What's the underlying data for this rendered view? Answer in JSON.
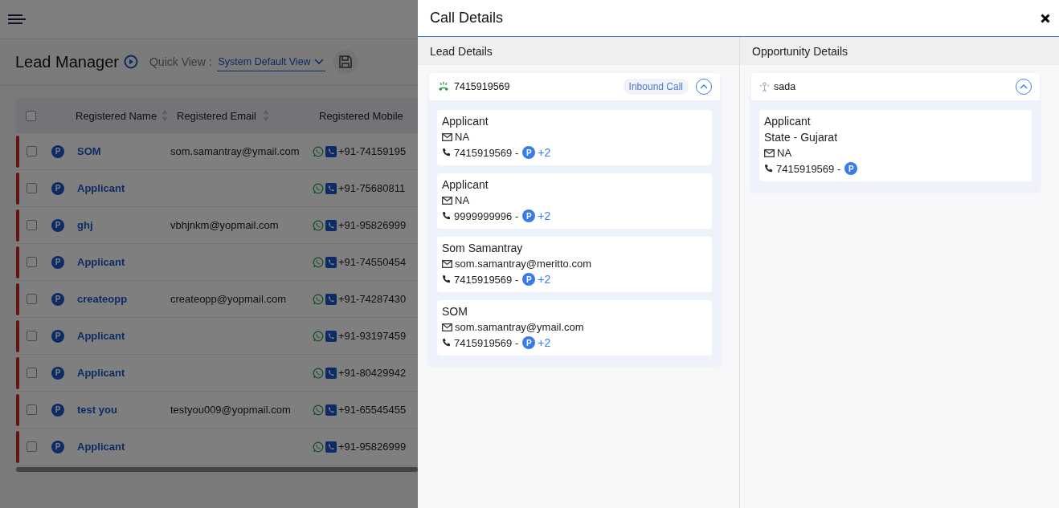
{
  "page": {
    "title": "Lead Manager",
    "quick_view_label": "Quick View :",
    "quick_view_value": "System Default View"
  },
  "table": {
    "header_checkbox": {
      "checked": false
    },
    "columns": [
      "Registered Name",
      "Registered Email",
      "Registered Mobile"
    ],
    "rows": [
      {
        "checked": false,
        "badge": "P",
        "name": "SOM",
        "email": "som.samantray@ymail.com",
        "mobile": "+91-74159195"
      },
      {
        "checked": false,
        "badge": "P",
        "name": "Applicant",
        "email": "",
        "mobile": "+91-75680811"
      },
      {
        "checked": false,
        "badge": "P",
        "name": "ghj",
        "email": "vbhjnkm@yopmail.com",
        "mobile": "+91-95826999"
      },
      {
        "checked": false,
        "badge": "P",
        "name": "Applicant",
        "email": "",
        "mobile": "+91-74550454"
      },
      {
        "checked": false,
        "badge": "P",
        "name": "createopp",
        "email": "createopp@yopmail.com",
        "mobile": "+91-74287430"
      },
      {
        "checked": false,
        "badge": "P",
        "name": "Applicant",
        "email": "",
        "mobile": "+91-93197459"
      },
      {
        "checked": false,
        "badge": "P",
        "name": "Applicant",
        "email": "",
        "mobile": "+91-80429942"
      },
      {
        "checked": false,
        "badge": "P",
        "name": "test you",
        "email": "testyou009@yopmail.com",
        "mobile": "+91-65545455"
      },
      {
        "checked": false,
        "badge": "P",
        "name": "Applicant",
        "email": "",
        "mobile": "+91-95826999"
      }
    ]
  },
  "drawer": {
    "title": "Call Details",
    "lead": {
      "heading": "Lead Details",
      "card": {
        "kind": "call",
        "number": "7415919569",
        "tag": "Inbound Call",
        "expanded": true,
        "contacts": [
          {
            "name": "Applicant",
            "email": "NA",
            "phone": "7415919569 -",
            "badge": "P",
            "extra": "+2"
          },
          {
            "name": "Applicant",
            "email": "NA",
            "phone": "9999999996 -",
            "badge": "P",
            "extra": "+2"
          },
          {
            "name": "Som Samantray",
            "email": "som.samantray@meritto.com",
            "phone": "7415919569 -",
            "badge": "P",
            "extra": "+2"
          },
          {
            "name": "SOM",
            "email": "som.samantray@ymail.com",
            "phone": "7415919569 -",
            "badge": "P",
            "extra": "+2"
          }
        ]
      }
    },
    "opportunity": {
      "heading": "Opportunity Details",
      "card": {
        "kind": "person",
        "number": "sada",
        "expanded": true,
        "contacts": [
          {
            "name": "Applicant",
            "state": "State - Gujarat",
            "email": "NA",
            "phone": "7415919569 -",
            "badge": "P"
          }
        ]
      }
    }
  }
}
